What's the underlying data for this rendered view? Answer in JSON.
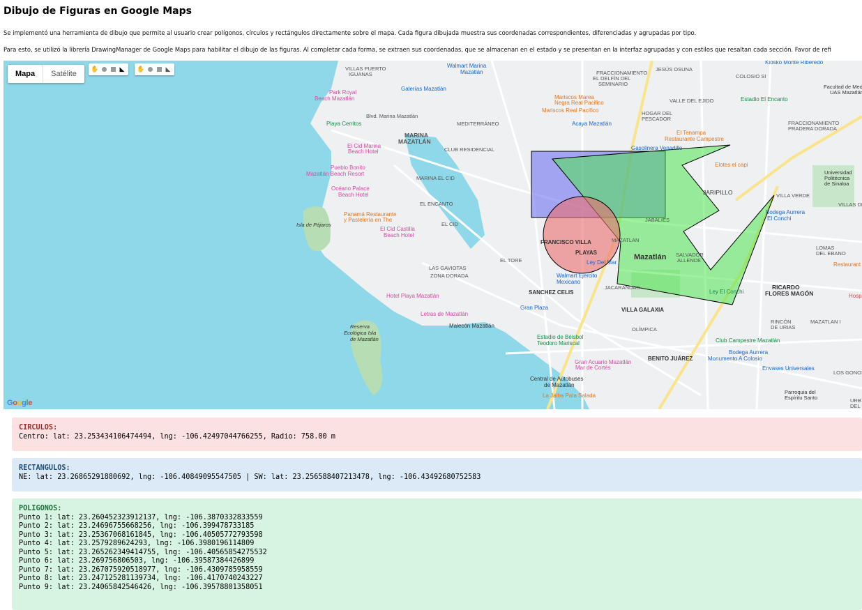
{
  "title": "Dibujo de Figuras en Google Maps",
  "paragraphs": [
    "Se implementó una herramienta de dibujo que permite al usuario crear polígonos, círculos y rectángulos directamente sobre el mapa. Cada figura dibujada muestra sus coordenadas correspondientes, diferenciadas y agrupadas por tipo.",
    "Para esto, se utilizó la librería DrawingManager de Google Maps para habilitar el dibujo de las figuras. Al completar cada forma, se extraen sus coordenadas, que se almacenan en el estado y se presentan en la interfaz agrupadas y con estilos que resaltan cada sección. Favor de refi"
  ],
  "map": {
    "type_controls": {
      "map": "Mapa",
      "satellite": "Satélite"
    },
    "drawing_tools": [
      "hand-icon",
      "circle-tool-icon",
      "rectangle-tool-icon",
      "polygon-tool-icon"
    ],
    "google_logo": "Google",
    "colors": {
      "water": "#8fd8ea",
      "land": "#eef0f2",
      "park": "#c8e6c9",
      "road": "#ffffff",
      "highway": "#f9e48c",
      "rectangle_fill": "#7b7bf0",
      "circle_fill": "#ef7f7f",
      "polygon_fill": "#5ef05e"
    },
    "labels": [
      "VILLAS PUERTO IGUANAS",
      "Walmart Marina Mazatlán",
      "FRACCIONAMIENTO EL DELFÍN DEL SEMINARIO",
      "JESÚS OSUNA",
      "Kiosko Monte Riberedo",
      "COLOSIO SI",
      "Facultad de Medi UAS Mazatlán",
      "Park Royal Beach Mazatlán",
      "Galerías Mazatlán",
      "Mariscos Marea Negra Real Pacifico",
      "Mariscos Real Pacífico",
      "VALLE DEL EJIDO",
      "Estadio El Encanto",
      "HOGAR DEL PESCADOR",
      "Playa Cerritos",
      "Blvd. Marina Mazatlán",
      "Acaya Mazatlán",
      "FRACCIONAMIENTO PRADERA DORADA",
      "MARINA MAZATLÁN",
      "MEDITERRÁNEO CLUB RESIDENCIAL",
      "El Tenampa Restaurante Campestre",
      "Gasolinera Venadillo",
      "El Cid Marina Beach Hotel",
      "Pueblo Bonito Mazatlán Beach Resort",
      "MARINA EL CID",
      "Elotes el capi",
      "Universidad Politécnica de Sinaloa",
      "Océano Palace Beach Hotel",
      "JARIPILLO",
      "VILLA VERDE",
      "EL ENCANTO",
      "Panamá Restaurante y Pastelería en The",
      "Isla de Pájaros",
      "El Cid Castilla Beach Hotel",
      "EL CID",
      "JABALIES",
      "Bodega Aurrera El Conchi",
      "VILLAS DEL",
      "FRANCISCO VILLA",
      "PLAYAS",
      "MAZATLAN",
      "Mazatlán",
      "LOMAS DEL EBANO",
      "EL TORE",
      "SALVADOR ALLENDE",
      "Ley Del Mar",
      "Restaurant",
      "LAS GAVIOTAS",
      "ZONA DORADA",
      "Walmart Ejercito Mexicano",
      "SANCHEZ CELIS",
      "JACARANDAS",
      "Ley El Conchi",
      "RICARDO FLORES MAGÓN",
      "Hosp",
      "Hotel Playa Mazatlán",
      "Gran Plaza",
      "VILLA GALAXIA",
      "Letras de Mazatlán",
      "Malecón Mazatlán",
      "Reserva Ecológica Isla de Mazatlán",
      "Estadio de Béisbol Teodoro Mariscal",
      "OLÍMPICA",
      "RINCÓN DE URIAS",
      "MAZATLAN I",
      "Club Campestre Mazatlán",
      "Bodega Aurrera Monumento A Colosio",
      "BENITO JUÁREZ",
      "Gran Acuario Mazatlán Mar de Cortés",
      "Envases Universales",
      "Central de Autobuses de Mazatlán",
      "Parroquia del Espíritu Santo",
      "La Jaiba Pata Salada",
      "URB DEL E",
      "LOS GONOS"
    ]
  },
  "sections": {
    "circles": {
      "heading": "CIRCULOS:",
      "lines": [
        "Centro: lat: 23.253434106474494, lng: -106.42497044766255, Radio: 758.00 m"
      ]
    },
    "rectangles": {
      "heading": "RECTANGULOS:",
      "lines": [
        "NE: lat: 23.26865291880692, lng: -106.40849095547505 | SW: lat: 23.256588407213478, lng: -106.43492680752583"
      ]
    },
    "polygons": {
      "heading": "POLIGONOS:",
      "lines": [
        "Punto 1: lat: 23.260452323912137, lng: -106.3870332833559",
        "Punto 2: lat: 23.24696755668256, lng: -106.399478733185",
        "Punto 3: lat: 23.25367068161845, lng: -106.40505772793598",
        "Punto 4: lat: 23.2579289624293, lng: -106.3980196114809",
        "Punto 5: lat: 23.265262349414755, lng: -106.40565854275532",
        "Punto 6: lat: 23.269756806503, lng: -106.39587384426899",
        "Punto 7: lat: 23.267075920518977, lng: -106.4309785958559",
        "Punto 8: lat: 23.247125281139734, lng: -106.4170740243227",
        "Punto 9: lat: 23.24065842546426, lng: -106.39578801358051"
      ]
    }
  }
}
